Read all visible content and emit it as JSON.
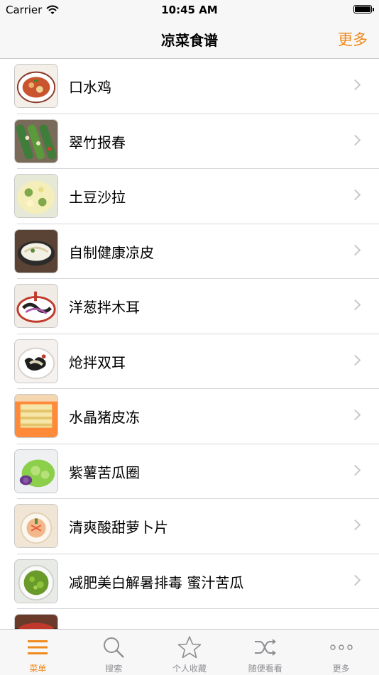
{
  "status_bar": {
    "carrier": "Carrier",
    "time": "10:45 AM",
    "battery_level": 1.0
  },
  "nav": {
    "title": "凉菜食谱",
    "more_label": "更多"
  },
  "recipes": [
    {
      "name": "口水鸡"
    },
    {
      "name": "翠竹报春"
    },
    {
      "name": "土豆沙拉"
    },
    {
      "name": "自制健康凉皮"
    },
    {
      "name": "洋葱拌木耳"
    },
    {
      "name": "炝拌双耳"
    },
    {
      "name": "水晶猪皮冻"
    },
    {
      "name": "紫薯苦瓜圈"
    },
    {
      "name": "清爽酸甜萝卜片"
    },
    {
      "name": "减肥美白解暑排毒 蜜汁苦瓜"
    },
    {
      "name": ""
    }
  ],
  "tabs": [
    {
      "label": "菜单",
      "icon": "menu-icon",
      "active": true
    },
    {
      "label": "搜索",
      "icon": "search-icon",
      "active": false
    },
    {
      "label": "个人收藏",
      "icon": "star-icon",
      "active": false
    },
    {
      "label": "随便看看",
      "icon": "shuffle-icon",
      "active": false
    },
    {
      "label": "更多",
      "icon": "more-icon",
      "active": false
    }
  ],
  "colors": {
    "accent": "#f08a1c",
    "inactive": "#8e8e93",
    "bar_bg": "#f7f7f7"
  }
}
